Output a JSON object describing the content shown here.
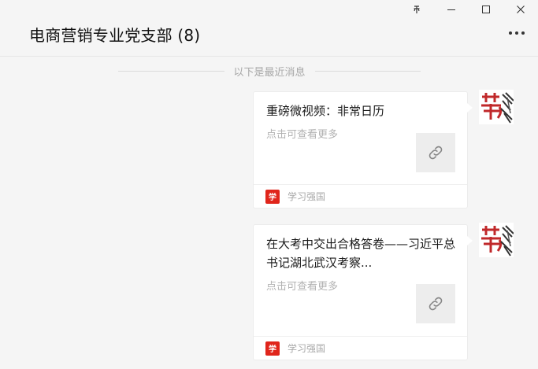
{
  "window": {
    "pin_glyph": "⊼",
    "minimize_label": "minimize",
    "maximize_label": "maximize",
    "close_label": "close"
  },
  "chat": {
    "title": "电商营销专业党支部 (8)"
  },
  "divider": {
    "text": "以下是最近消息"
  },
  "messages": [
    {
      "title": "重磅微视频：非常日历",
      "desc": "点击可查看更多",
      "source": "学习强国",
      "source_logo": "学"
    },
    {
      "title": "在大考中交出合格答卷——习近平总书记湖北武汉考察...",
      "desc": "点击可查看更多",
      "source": "学习强国",
      "source_logo": "学"
    }
  ]
}
